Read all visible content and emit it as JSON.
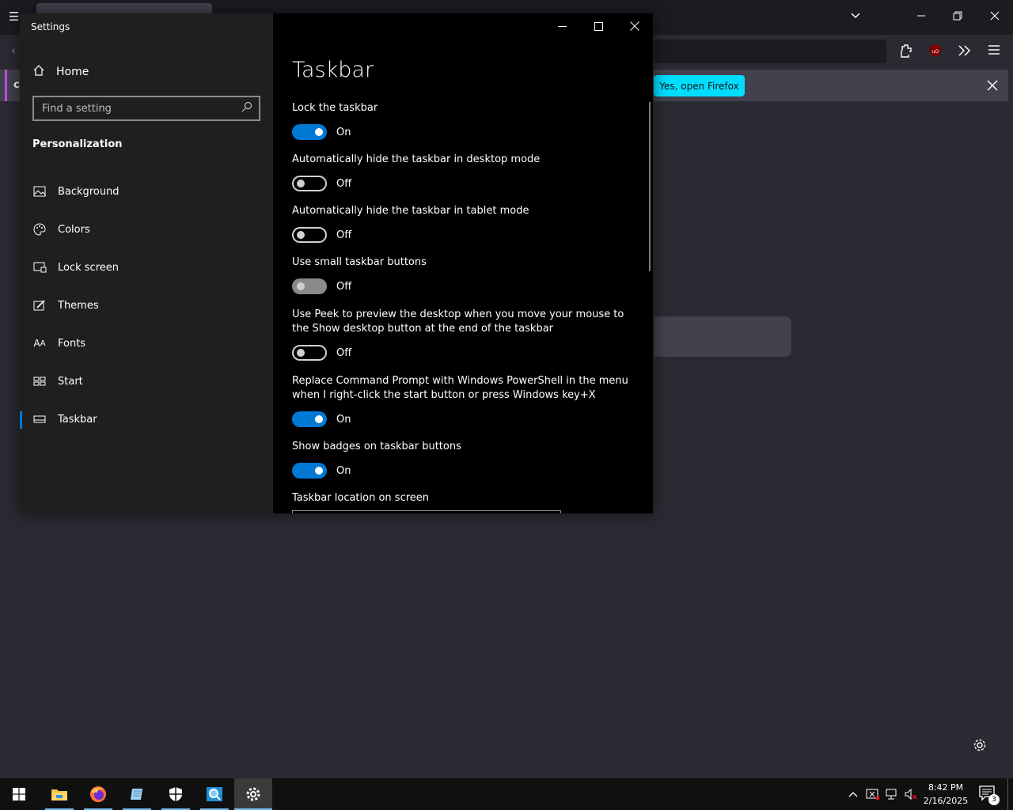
{
  "firefox": {
    "notice_button": "Yes, open Firefox",
    "notice_letter": "c"
  },
  "settings": {
    "window_title": "Settings",
    "home_label": "Home",
    "search_placeholder": "Find a setting",
    "section_title": "Personalization",
    "nav_items": [
      {
        "label": "Background",
        "icon": "image-icon"
      },
      {
        "label": "Colors",
        "icon": "palette-icon"
      },
      {
        "label": "Lock screen",
        "icon": "lock-screen-icon"
      },
      {
        "label": "Themes",
        "icon": "brush-icon"
      },
      {
        "label": "Fonts",
        "icon": "font-icon"
      },
      {
        "label": "Start",
        "icon": "start-icon"
      },
      {
        "label": "Taskbar",
        "icon": "taskbar-icon",
        "active": true
      }
    ],
    "page_title": "Taskbar",
    "options": [
      {
        "label": "Lock the taskbar",
        "state": "On"
      },
      {
        "label": "Automatically hide the taskbar in desktop mode",
        "state": "Off"
      },
      {
        "label": "Automatically hide the taskbar in tablet mode",
        "state": "Off"
      },
      {
        "label": "Use small taskbar buttons",
        "state": "Off",
        "disabled": true
      },
      {
        "label": "Use Peek to preview the desktop when you move your mouse to the Show desktop button at the end of the taskbar",
        "state": "Off"
      },
      {
        "label": "Replace Command Prompt with Windows PowerShell in the menu when I right-click the start button or press Windows key+X",
        "state": "On"
      },
      {
        "label": "Show badges on taskbar buttons",
        "state": "On"
      }
    ],
    "location_label": "Taskbar location on screen"
  },
  "taskbar": {
    "time": "8:42 PM",
    "date": "2/16/2025",
    "notification_count": "3"
  },
  "colors": {
    "accent": "#0078d4",
    "firefox_cyan": "#00ddff"
  }
}
